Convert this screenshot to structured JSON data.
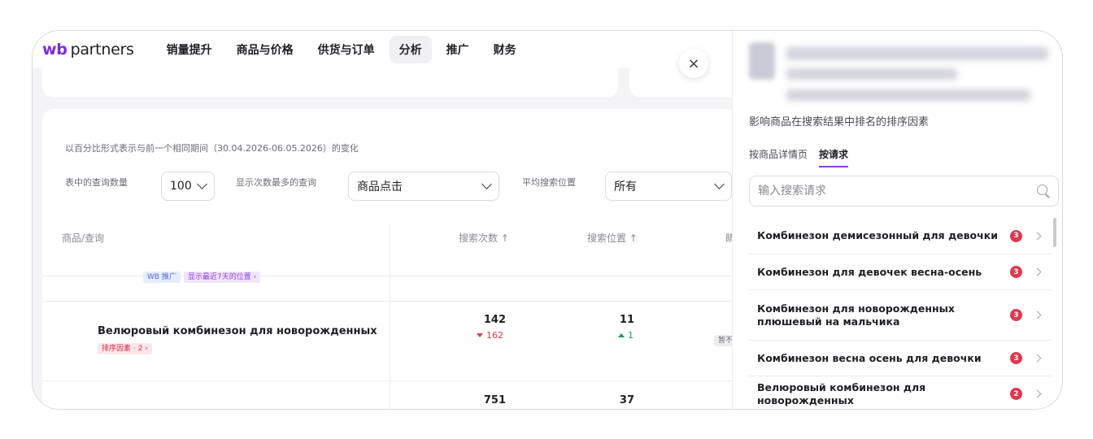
{
  "logo": {
    "wb": "wb",
    "partners": "partners"
  },
  "nav": [
    {
      "label": "销量提升",
      "active": false
    },
    {
      "label": "商品与价格",
      "active": false
    },
    {
      "label": "供货与订单",
      "active": false
    },
    {
      "label": "分析",
      "active": true
    },
    {
      "label": "推广",
      "active": false
    },
    {
      "label": "财务",
      "active": false
    }
  ],
  "close_label": "×",
  "main": {
    "caption": "以百分比形式表示与前一个相同期间（30.04.2026-06.05.2026）的变化",
    "filters": {
      "count_label": "表中的查询数量",
      "count_value": "100",
      "top_label": "显示次数最多的查询",
      "top_value": "商品点击",
      "pos_label": "平均搜索位置",
      "pos_value": "所有"
    },
    "table": {
      "col_product": "商品/查询",
      "col_searches": "搜索次数 ↑",
      "col_position": "搜索位置 ↑",
      "col_cut": "睛",
      "row0_tags": [
        "WB 推广",
        "显示最近7天的位置 ›"
      ],
      "rows": [
        {
          "title": "Велюровый комбинезон для новорожденных",
          "tag": "排序因素 · 2 ›",
          "searches": "142",
          "searches_delta": "162",
          "position": "11",
          "position_delta": "1",
          "status": "暂不"
        },
        {
          "title": "",
          "searches": "751",
          "position": "37"
        }
      ]
    }
  },
  "panel": {
    "subtitle": "影响商品在搜索结果中排名的排序因素",
    "tabs": [
      {
        "label": "按商品详情页",
        "active": false
      },
      {
        "label": "按请求",
        "active": true
      }
    ],
    "search_placeholder": "输入搜索请求",
    "items": [
      {
        "text": "Комбинезон демисезонный для девочки",
        "badge": "3"
      },
      {
        "text": "Комбинезон для девочек весна-осень",
        "badge": "3"
      },
      {
        "text": "Комбинезон для новорожденных плюшевый на мальчика",
        "badge": "3"
      },
      {
        "text": "Комбинезон весна осень для девочки",
        "badge": "3"
      },
      {
        "text": "Велюровый комбинезон для новорожденных",
        "badge": "2"
      }
    ]
  },
  "colors": {
    "brand": "#7b2ce0",
    "badge": "#e0384f",
    "up": "#1f9a52",
    "accent_tab": "#8d3bd8"
  }
}
